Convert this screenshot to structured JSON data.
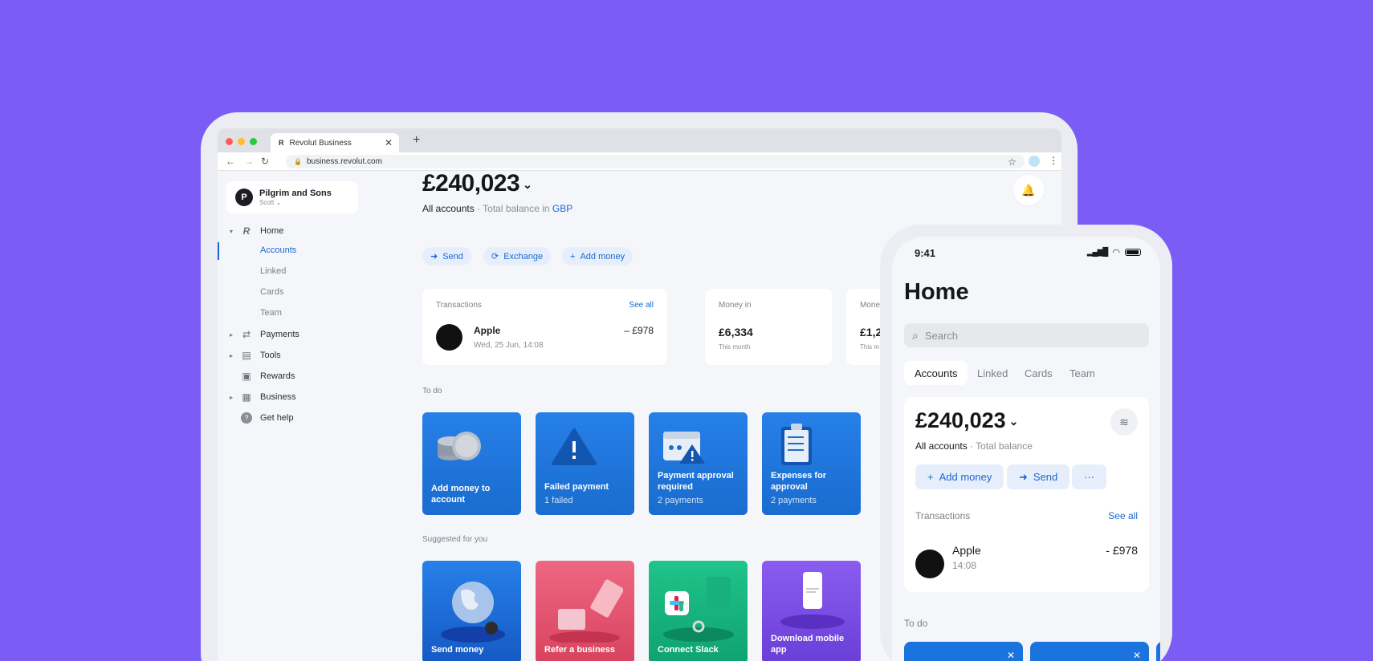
{
  "browser": {
    "tab_title": "Revolut Business",
    "url": "business.revolut.com"
  },
  "sidebar": {
    "org_name": "Pilgrim and Sons",
    "org_initial": "P",
    "org_user": "Scott",
    "items": [
      {
        "label": "Home"
      },
      {
        "label": "Accounts"
      },
      {
        "label": "Linked"
      },
      {
        "label": "Cards"
      },
      {
        "label": "Team"
      },
      {
        "label": "Payments"
      },
      {
        "label": "Tools"
      },
      {
        "label": "Rewards"
      },
      {
        "label": "Business"
      },
      {
        "label": "Get help"
      }
    ]
  },
  "main": {
    "balance": "£240,023",
    "accounts_label": "All accounts",
    "total_prefix": " · Total balance in ",
    "currency": "GBP",
    "actions": [
      "Send",
      "Exchange",
      "Add money"
    ],
    "transactions": {
      "title": "Transactions",
      "see_all": "See all",
      "merchant": "Apple",
      "date": "Wed, 25 Jun, 14:08",
      "amount": "– £978"
    },
    "money_in": {
      "title": "Money in",
      "value": "£6,334",
      "period": "This month"
    },
    "money_out": {
      "title": "Mone",
      "value": "£1,2",
      "period": "This m"
    },
    "todo_title": "To do",
    "todo": [
      {
        "title": "Add money to account",
        "sub": ""
      },
      {
        "title": "Failed payment",
        "sub": "1 failed"
      },
      {
        "title": "Payment approval required",
        "sub": "2 payments"
      },
      {
        "title": "Expenses for approval",
        "sub": "2 payments"
      }
    ],
    "suggested_title": "Suggested for you",
    "suggested": [
      {
        "title": "Send money",
        "color": "#1F6FDB"
      },
      {
        "title": "Refer a business",
        "color": "#E45470"
      },
      {
        "title": "Connect Slack",
        "color": "#17B57F"
      },
      {
        "title": "Download mobile app",
        "color": "#7B4FE0"
      }
    ]
  },
  "phone": {
    "time": "9:41",
    "title": "Home",
    "search_placeholder": "Search",
    "tabs": [
      "Accounts",
      "Linked",
      "Cards",
      "Team"
    ],
    "balance": "£240,023",
    "accounts_label": "All accounts",
    "total_label": "Total balance",
    "actions": [
      "Add money",
      "Send",
      "···"
    ],
    "transactions_title": "Transactions",
    "see_all": "See all",
    "merchant": "Apple",
    "time_of_tx": "14:08",
    "amount": "- £978",
    "todo_title": "To do"
  },
  "colors": {
    "background": "#7B5CF5",
    "accent": "#1769D1",
    "tile_blue": "#1A6CCF"
  }
}
